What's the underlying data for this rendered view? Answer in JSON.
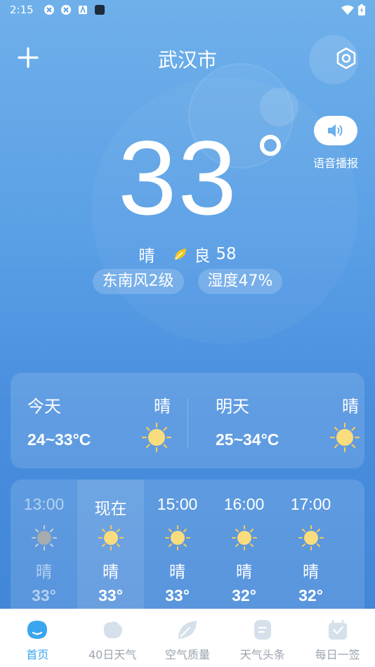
{
  "statusbar": {
    "time": "2:15"
  },
  "header": {
    "city": "武汉市"
  },
  "current": {
    "temp": "33",
    "condition": "晴",
    "aqi_label": "良",
    "aqi_value": "58",
    "wind": "东南风2级",
    "humidity": "湿度47%",
    "voice_label": "语音播报"
  },
  "days": [
    {
      "label": "今天",
      "condition": "晴",
      "range": "24~33°C"
    },
    {
      "label": "明天",
      "condition": "晴",
      "range": "25~34°C"
    }
  ],
  "hours": [
    {
      "time": "13:00",
      "condition": "晴",
      "temp": "33°"
    },
    {
      "time": "现在",
      "condition": "晴",
      "temp": "33°"
    },
    {
      "time": "15:00",
      "condition": "晴",
      "temp": "33°"
    },
    {
      "time": "16:00",
      "condition": "晴",
      "temp": "32°"
    },
    {
      "time": "17:00",
      "condition": "晴",
      "temp": "32°"
    }
  ],
  "nav": [
    {
      "label": "首页",
      "icon": "home-icon"
    },
    {
      "label": "40日天气",
      "icon": "forecast-40-icon"
    },
    {
      "label": "空气质量",
      "icon": "leaf-icon"
    },
    {
      "label": "天气头条",
      "icon": "news-icon"
    },
    {
      "label": "每日一签",
      "icon": "daily-sign-icon"
    }
  ],
  "colors": {
    "accent": "#3aa6f0",
    "sun": "#f7d36b",
    "leaf": "#f5c518"
  }
}
